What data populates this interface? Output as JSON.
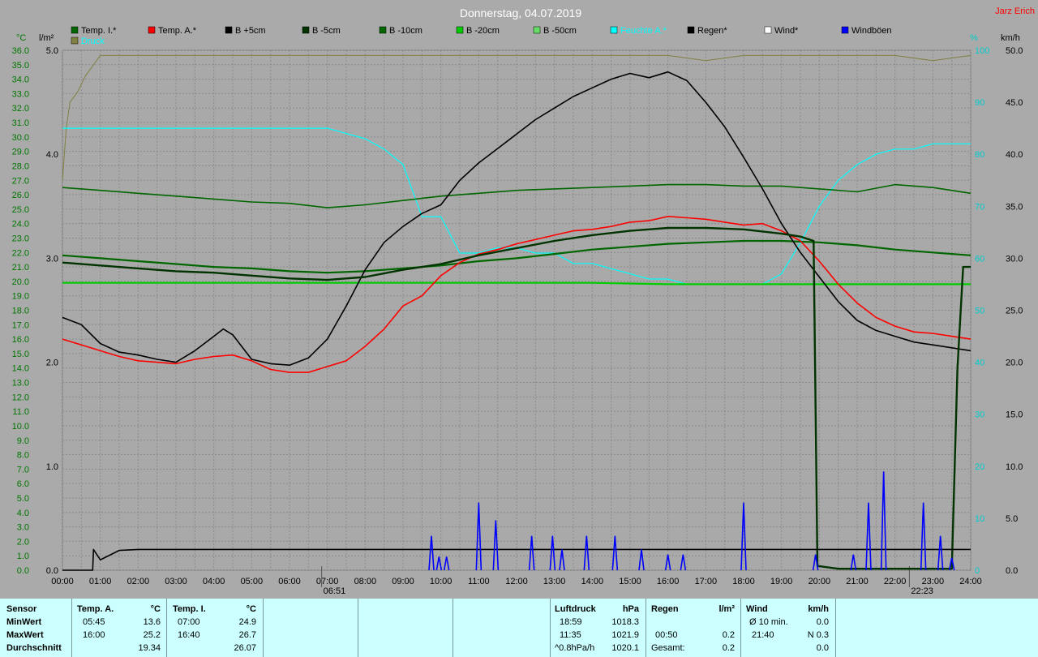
{
  "chart_data": {
    "type": "line",
    "title": "Donnerstag, 04.07.2019",
    "author": "Jarz Erich",
    "axes": {
      "left_temp": {
        "unit": "°C",
        "range": [
          0,
          36
        ],
        "ticks": [
          "0.0",
          "1.0",
          "2.0",
          "3.0",
          "4.0",
          "5.0",
          "6.0",
          "7.0",
          "8.0",
          "9.0",
          "10.0",
          "11.0",
          "12.0",
          "13.0",
          "14.0",
          "15.0",
          "16.0",
          "17.0",
          "18.0",
          "19.0",
          "20.0",
          "21.0",
          "22.0",
          "23.0",
          "24.0",
          "25.0",
          "26.0",
          "27.0",
          "28.0",
          "29.0",
          "30.0",
          "31.0",
          "32.0",
          "33.0",
          "34.0",
          "35.0",
          "36.0"
        ]
      },
      "left_rain": {
        "unit": "l/m²",
        "range": [
          0,
          5
        ],
        "ticks": [
          "0.0",
          "1.0",
          "2.0",
          "3.0",
          "4.0",
          "5.0"
        ]
      },
      "right_humidity": {
        "unit": "%",
        "range": [
          0,
          100
        ],
        "ticks": [
          "0",
          "10",
          "20",
          "30",
          "40",
          "50",
          "60",
          "70",
          "80",
          "90",
          "100"
        ]
      },
      "right_wind": {
        "unit": "km/h",
        "range": [
          0,
          50
        ],
        "ticks": [
          "0.0",
          "5.0",
          "10.0",
          "15.0",
          "20.0",
          "25.0",
          "30.0",
          "35.0",
          "40.0",
          "45.0",
          "50.0"
        ]
      },
      "x": {
        "unit": "h",
        "range": [
          0,
          24
        ],
        "ticks": [
          "00:00",
          "01:00",
          "02:00",
          "03:00",
          "04:00",
          "05:00",
          "06:00",
          "07:00",
          "08:00",
          "09:00",
          "10:00",
          "11:00",
          "12:00",
          "13:00",
          "14:00",
          "15:00",
          "16:00",
          "17:00",
          "18:00",
          "19:00",
          "20:00",
          "21:00",
          "22:00",
          "23:00",
          "24:00"
        ]
      }
    },
    "markers": [
      {
        "label": "06:51",
        "x": 6.85
      },
      {
        "label": "22:23",
        "x": 22.38
      }
    ],
    "legend": [
      {
        "name": "Temp. I.*",
        "color": "#006600"
      },
      {
        "name": "Temp. A.*",
        "color": "#ff0000"
      },
      {
        "name": "B +5cm",
        "color": "#000000"
      },
      {
        "name": "B -5cm",
        "color": "#003300"
      },
      {
        "name": "B -10cm",
        "color": "#006600"
      },
      {
        "name": "B -20cm",
        "color": "#00cc00"
      },
      {
        "name": "B -50cm",
        "color": "#66dd66"
      },
      {
        "name": "Feuchte A.*",
        "color": "#00ffff"
      },
      {
        "name": "Regen*",
        "color": "#000000"
      },
      {
        "name": "Wind*",
        "color": "#ffffff"
      },
      {
        "name": "Windböen",
        "color": "#0000ff"
      },
      {
        "name": "Druck",
        "color": "#808040"
      }
    ],
    "series": [
      {
        "name": "Temp. I.*",
        "axis": "left_temp",
        "color": "#006600",
        "x": [
          0,
          1,
          2,
          3,
          4,
          5,
          6,
          7,
          8,
          9,
          10,
          11,
          12,
          13,
          14,
          15,
          16,
          17,
          18,
          19,
          20,
          21,
          22,
          23,
          24
        ],
        "y": [
          26.5,
          26.3,
          26.1,
          25.9,
          25.7,
          25.5,
          25.4,
          25.1,
          25.3,
          25.6,
          25.9,
          26.1,
          26.3,
          26.4,
          26.5,
          26.6,
          26.7,
          26.7,
          26.6,
          26.6,
          26.4,
          26.2,
          26.7,
          26.5,
          26.1
        ]
      },
      {
        "name": "Temp. A.*",
        "axis": "left_temp",
        "color": "#ff0000",
        "x": [
          0,
          0.5,
          1,
          1.5,
          2,
          2.5,
          3,
          3.5,
          4,
          4.5,
          5,
          5.5,
          6,
          6.5,
          7,
          7.5,
          8,
          8.5,
          9,
          9.5,
          10,
          10.5,
          11,
          11.5,
          12,
          12.5,
          13,
          13.5,
          14,
          14.5,
          15,
          15.5,
          16,
          16.5,
          17,
          17.5,
          18,
          18.5,
          19,
          19.5,
          20,
          20.5,
          21,
          21.5,
          22,
          22.5,
          23,
          23.5,
          24
        ],
        "y": [
          16.0,
          15.6,
          15.2,
          14.8,
          14.5,
          14.4,
          14.3,
          14.6,
          14.8,
          14.9,
          14.5,
          13.9,
          13.7,
          13.7,
          14.1,
          14.5,
          15.5,
          16.7,
          18.3,
          19.0,
          20.4,
          21.3,
          21.9,
          22.2,
          22.6,
          22.9,
          23.2,
          23.5,
          23.6,
          23.8,
          24.1,
          24.2,
          24.5,
          24.4,
          24.3,
          24.1,
          23.9,
          24.0,
          23.5,
          22.8,
          21.4,
          19.8,
          18.5,
          17.5,
          16.9,
          16.5,
          16.4,
          16.2,
          16.0
        ]
      },
      {
        "name": "B +5cm",
        "axis": "left_temp",
        "color": "#000000",
        "x": [
          0,
          0.5,
          1,
          1.5,
          2,
          2.5,
          3,
          3.5,
          4,
          4.25,
          4.5,
          5,
          5.5,
          6,
          6.5,
          7,
          7.5,
          8,
          8.5,
          9,
          9.5,
          10,
          10.5,
          11,
          11.5,
          12,
          12.5,
          13,
          13.5,
          14,
          14.5,
          15,
          15.5,
          16,
          16.5,
          17,
          17.5,
          18,
          18.5,
          19,
          19.5,
          20,
          20.5,
          21,
          21.5,
          22,
          22.5,
          23,
          23.5,
          24
        ],
        "y": [
          17.5,
          17.0,
          15.7,
          15.1,
          14.9,
          14.6,
          14.4,
          15.2,
          16.2,
          16.7,
          16.3,
          14.6,
          14.3,
          14.2,
          14.7,
          16.0,
          18.3,
          20.8,
          22.7,
          23.8,
          24.7,
          25.3,
          27.0,
          28.2,
          29.2,
          30.2,
          31.2,
          32.0,
          32.8,
          33.4,
          34.0,
          34.4,
          34.1,
          34.5,
          33.9,
          32.4,
          30.7,
          28.6,
          26.4,
          24.0,
          22.0,
          20.3,
          18.6,
          17.3,
          16.6,
          16.2,
          15.8,
          15.6,
          15.4,
          15.2
        ]
      },
      {
        "name": "B -5cm",
        "axis": "left_temp",
        "color": "#003300",
        "x": [
          0,
          1,
          2,
          3,
          4,
          5,
          6,
          7,
          8,
          9,
          10,
          11,
          12,
          13,
          14,
          15,
          16,
          17,
          18,
          19,
          19.5,
          19.85,
          19.95,
          20.5,
          21,
          22,
          23,
          23.5,
          23.65,
          23.8,
          24
        ],
        "y": [
          21.3,
          21.1,
          20.9,
          20.7,
          20.6,
          20.4,
          20.2,
          20.1,
          20.3,
          20.8,
          21.2,
          21.8,
          22.3,
          22.8,
          23.2,
          23.5,
          23.7,
          23.7,
          23.6,
          23.3,
          23.1,
          22.8,
          0.3,
          0.1,
          0.1,
          0.1,
          0.1,
          0.1,
          14.0,
          21.0,
          21.0
        ]
      },
      {
        "name": "B -10cm",
        "axis": "left_temp",
        "color": "#006600",
        "x": [
          0,
          1,
          2,
          3,
          4,
          5,
          6,
          7,
          8,
          9,
          10,
          11,
          12,
          13,
          14,
          15,
          16,
          17,
          18,
          19,
          20,
          21,
          22,
          23,
          24
        ],
        "y": [
          21.8,
          21.6,
          21.4,
          21.2,
          21.0,
          20.9,
          20.7,
          20.6,
          20.7,
          20.9,
          21.1,
          21.4,
          21.6,
          21.9,
          22.2,
          22.4,
          22.6,
          22.7,
          22.8,
          22.8,
          22.7,
          22.5,
          22.2,
          22.0,
          21.8
        ]
      },
      {
        "name": "B -20cm",
        "axis": "left_temp",
        "color": "#00cc00",
        "x": [
          0,
          2,
          4,
          6,
          8,
          10,
          12,
          14,
          16,
          18,
          20,
          22,
          24
        ],
        "y": [
          19.9,
          19.9,
          19.9,
          19.9,
          19.9,
          19.9,
          19.9,
          19.9,
          19.8,
          19.8,
          19.8,
          19.8,
          19.8
        ]
      },
      {
        "name": "Feuchte A.*",
        "axis": "right_humidity",
        "color": "#00ffff",
        "x": [
          0,
          1,
          2,
          3,
          4,
          5,
          6,
          7,
          7.5,
          8,
          8.5,
          9,
          9.5,
          10,
          10.5,
          11,
          11.5,
          12,
          12.5,
          13,
          13.5,
          14,
          14.5,
          15,
          15.5,
          16,
          16.5,
          17,
          17.5,
          18,
          18.5,
          19,
          19.5,
          20,
          20.5,
          21,
          21.5,
          22,
          22.5,
          23,
          23.5,
          24
        ],
        "y": [
          85,
          85,
          85,
          85,
          85,
          85,
          85,
          85,
          84,
          83,
          81,
          78,
          68,
          68,
          61,
          61,
          62,
          62,
          61,
          61,
          59,
          59,
          58,
          57,
          56,
          56,
          55,
          55,
          55,
          55,
          55,
          57,
          63,
          70,
          75,
          78,
          80,
          81,
          81,
          82,
          82,
          82
        ]
      },
      {
        "name": "Regen*",
        "axis": "left_rain",
        "color": "#000000",
        "x": [
          0,
          0.8,
          0.82,
          1.0,
          1.5,
          2,
          24
        ],
        "y": [
          0,
          0,
          0.2,
          0.1,
          0.19,
          0.2,
          0.2
        ]
      },
      {
        "name": "Druck",
        "axis": "right_humidity",
        "color": "#808040",
        "x": [
          0,
          0.1,
          0.2,
          0.4,
          0.6,
          1,
          2,
          3,
          4,
          5,
          6,
          7,
          8,
          9,
          10,
          11,
          12,
          13,
          14,
          15,
          16,
          17,
          18,
          19,
          20,
          21,
          22,
          23,
          24
        ],
        "y": [
          75,
          85,
          90,
          92,
          95,
          99,
          99,
          99,
          99,
          99,
          99,
          99,
          99,
          99,
          99,
          99,
          99,
          99,
          99,
          99,
          99,
          98,
          99,
          99,
          99,
          99,
          99,
          98,
          99
        ]
      }
    ],
    "gusts": {
      "name": "Windböen",
      "axis": "right_wind",
      "color": "#0000ff",
      "x": [
        9.75,
        9.95,
        10.15,
        11.0,
        11.45,
        12.4,
        12.95,
        13.2,
        13.85,
        14.6,
        15.3,
        16.0,
        16.4,
        18.0,
        19.9,
        20.9,
        21.3,
        21.7,
        22.75,
        23.2,
        23.5
      ],
      "y": [
        3.3,
        1.3,
        1.3,
        6.5,
        4.8,
        3.3,
        3.3,
        2.0,
        3.3,
        3.3,
        2.0,
        1.5,
        1.5,
        6.5,
        1.5,
        1.5,
        6.5,
        9.5,
        6.5,
        3.3,
        1.2
      ]
    }
  },
  "stats": {
    "sensor_label": "Sensor",
    "row_labels": [
      "MinWert",
      "MaxWert",
      "Durchschnitt"
    ],
    "temp_a": {
      "title": "Temp. A.",
      "unit": "°C",
      "min_time": "05:45",
      "min_val": "13.6",
      "max_time": "16:00",
      "max_val": "25.2",
      "avg": "19.34"
    },
    "temp_i": {
      "title": "Temp. I.",
      "unit": "°C",
      "min_time": "07:00",
      "min_val": "24.9",
      "max_time": "16:40",
      "max_val": "26.7",
      "avg": "26.07"
    },
    "pressure": {
      "title": "Luftdruck",
      "unit": "hPa",
      "min_time": "18:59",
      "min_val": "1018.3",
      "max_time": "11:35",
      "max_val": "1021.9",
      "avg_label": "^0.8hPa/h",
      "avg": "1020.1"
    },
    "rain": {
      "title": "Regen",
      "unit": "l/m²",
      "max_time": "00:50",
      "max_val": "0.2",
      "total_label": "Gesamt:",
      "total": "0.2"
    },
    "wind": {
      "title": "Wind",
      "unit": "km/h",
      "min_label": "Ø 10 min.",
      "min_val": "0.0",
      "max_time": "21:40",
      "max_val": "N 0.3",
      "avg": "0.0"
    }
  }
}
